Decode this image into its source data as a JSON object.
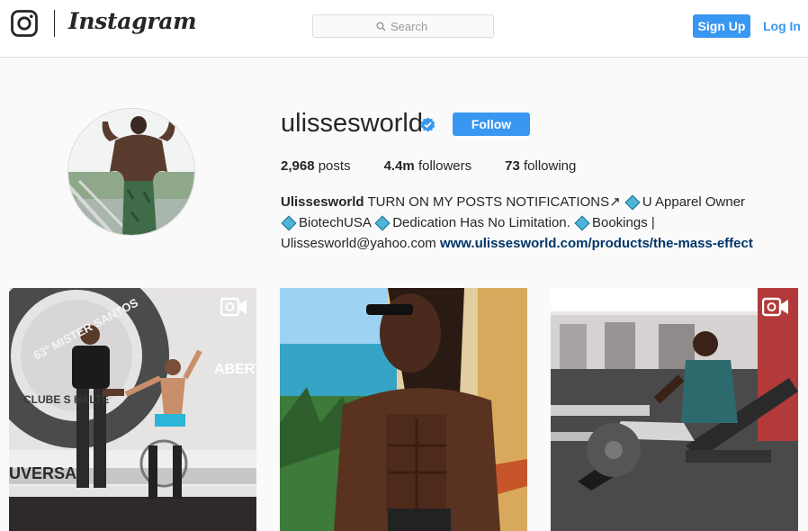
{
  "header": {
    "wordmark": "Instagram",
    "search": {
      "placeholder": "Search"
    },
    "signup_label": "Sign Up",
    "login_label": "Log In"
  },
  "profile": {
    "username": "ulissesworld",
    "verified": true,
    "follow_label": "Follow",
    "stats": {
      "posts_count": "2,968",
      "posts_label": "posts",
      "followers_count": "4.4m",
      "followers_label": "followers",
      "following_count": "73",
      "following_label": "following"
    },
    "bio": {
      "name": "Ulissesworld",
      "part1": "TURN ON MY POSTS NOTIFICATIONS↗",
      "part2": "U Apparel Owner",
      "part3": "BiotechUSA",
      "part4": "Dedication Has No Limitation.",
      "part5": "Bookings |",
      "email": "Ulissesworld@yahoo.com",
      "link": "www.ulissesworld.com/products/the-mass-effect"
    }
  },
  "posts": [
    {
      "type": "video",
      "banner_text": "63º MISTER SANTOS",
      "side_text": "ABERT",
      "bottom_text": "UVERSAL",
      "club_text": "CLUBE S HALTE"
    },
    {
      "type": "photo"
    },
    {
      "type": "video"
    }
  ],
  "colors": {
    "accent": "#3897f0",
    "link": "#003569",
    "border": "#dbdbdb",
    "background": "#fafafa"
  }
}
